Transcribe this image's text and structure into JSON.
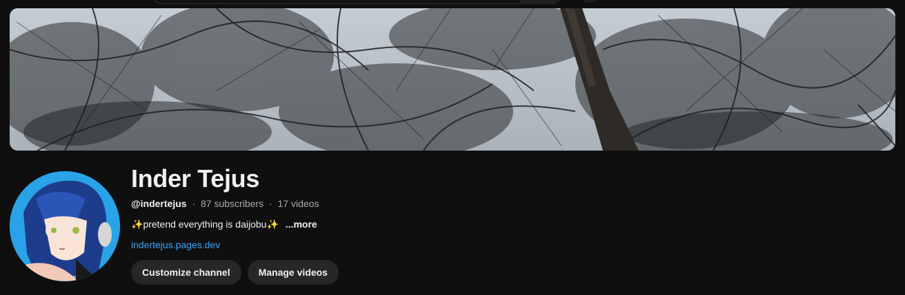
{
  "channel": {
    "name": "Inder Tejus",
    "handle": "@indertejus",
    "separator": "·",
    "subscribers": "87 subscribers",
    "videos": "17 videos",
    "sparkle_left": "✨",
    "description": "pretend everything is daijobu",
    "sparkle_right": "✨",
    "more_label": "...more",
    "link": "indertejus.pages.dev"
  },
  "actions": {
    "customize_label": "Customize channel",
    "manage_label": "Manage videos"
  },
  "colors": {
    "background": "#0f0f0f",
    "text_primary": "#f1f1f1",
    "text_secondary": "#aaaaaa",
    "link": "#3ea6ff",
    "button_bg": "#272727",
    "avatar_bg": "#29a3e8"
  }
}
